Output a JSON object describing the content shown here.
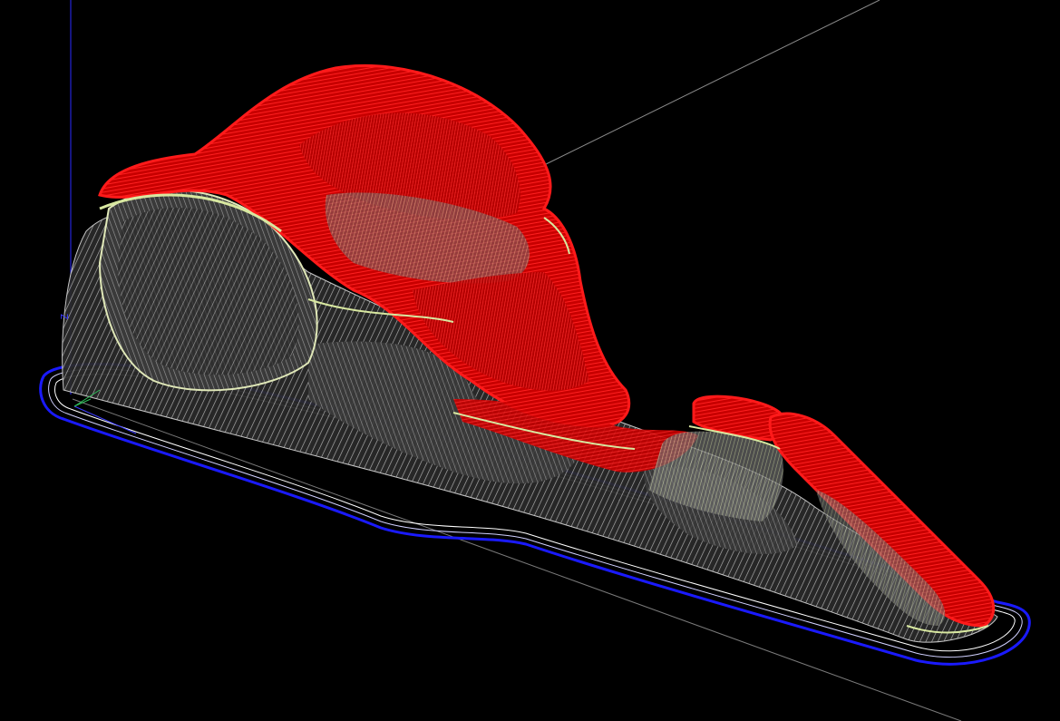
{
  "viewport": {
    "background": "#000000"
  },
  "axes": {
    "z_label": "Z",
    "x_color": "#2fbf5a",
    "y_color": "#3b3bff",
    "z_color": "#2a2aff",
    "x_label": "",
    "y_label": ""
  },
  "toolpath": {
    "stock_outline_color": "#1a1aff",
    "roughing_color": "#c8c8c8",
    "rest_color": "#8a8a8a",
    "finishing_color": "#ff1a1a",
    "transition_color": "#d8e8a0"
  },
  "reference_lines": {
    "color": "#8a8a8a"
  }
}
